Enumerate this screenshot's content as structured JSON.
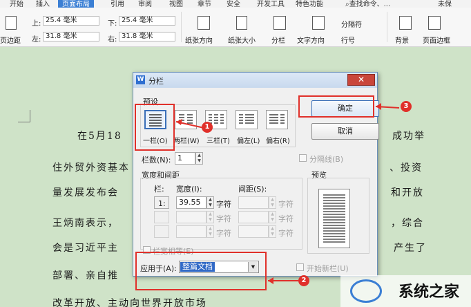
{
  "ribbon_tabs": [
    "开始",
    "插入",
    "页面布局",
    "引用",
    "审阅",
    "视图",
    "章节",
    "安全",
    "开发工具",
    "特色功能"
  ],
  "ribbon_active_tab": "页面布局",
  "ribbon_search": "查找命令、...",
  "ribbon_user": "未保",
  "ribbon": {
    "margins_label": "页边距",
    "top_label": "上:",
    "top_value": "25.4 毫米",
    "bottom_label": "下:",
    "bottom_value": "25.4 毫米",
    "left_label": "左:",
    "left_value": "31.8 毫米",
    "right_label": "右:",
    "right_value": "31.8 毫米",
    "orientation": "纸张方向",
    "size": "纸张大小",
    "columns": "分栏",
    "text_direction": "文字方向",
    "breaks": "分隔符",
    "line_numbers": "行号",
    "background": "背景",
    "page_border": "页面边框"
  },
  "document_lines": [
    {
      "left": "在5月18",
      "right": "成功举"
    },
    {
      "left": "住外贸外资基本",
      "right": "、投资"
    },
    {
      "left": "量发展发布会",
      "right": "和开放"
    },
    {
      "left": "王炳南表示，",
      "right": "，综合"
    },
    {
      "left": "会是习近平主",
      "right": "产生了"
    },
    {
      "left": "部署、亲自推",
      "right": ""
    },
    {
      "left": "改革开放、主动向世界开放市场",
      "right": ""
    }
  ],
  "dialog": {
    "title": "分栏",
    "close": "✕",
    "presets_label": "预设",
    "presets": [
      {
        "label": "一栏(O)",
        "cols": 1
      },
      {
        "label": "两栏(W)",
        "cols": 2
      },
      {
        "label": "三栏(T)",
        "cols": 3
      },
      {
        "label": "偏左(L)",
        "cols": 2
      },
      {
        "label": "偏右(R)",
        "cols": 2
      }
    ],
    "selected_preset": "一栏(O)",
    "ok": "确定",
    "cancel": "取消",
    "columns_count_label": "栏数(N):",
    "columns_count_value": "1",
    "divider_label": "分隔线(B)",
    "width_spacing_label": "宽度和间距",
    "col_header": "栏:",
    "width_header": "宽度(I):",
    "spacing_header": "间距(S):",
    "row1_col": "1:",
    "row1_width": "39.55",
    "unit": "字符",
    "equal_width_label": "栏宽相等(E)",
    "preview_label": "预览",
    "apply_to_label": "应用于(A):",
    "apply_to_value": "整篇文档",
    "new_column_label": "开始新栏(U)"
  },
  "annotations": [
    "1",
    "2",
    "3"
  ],
  "watermark": "系统之家"
}
